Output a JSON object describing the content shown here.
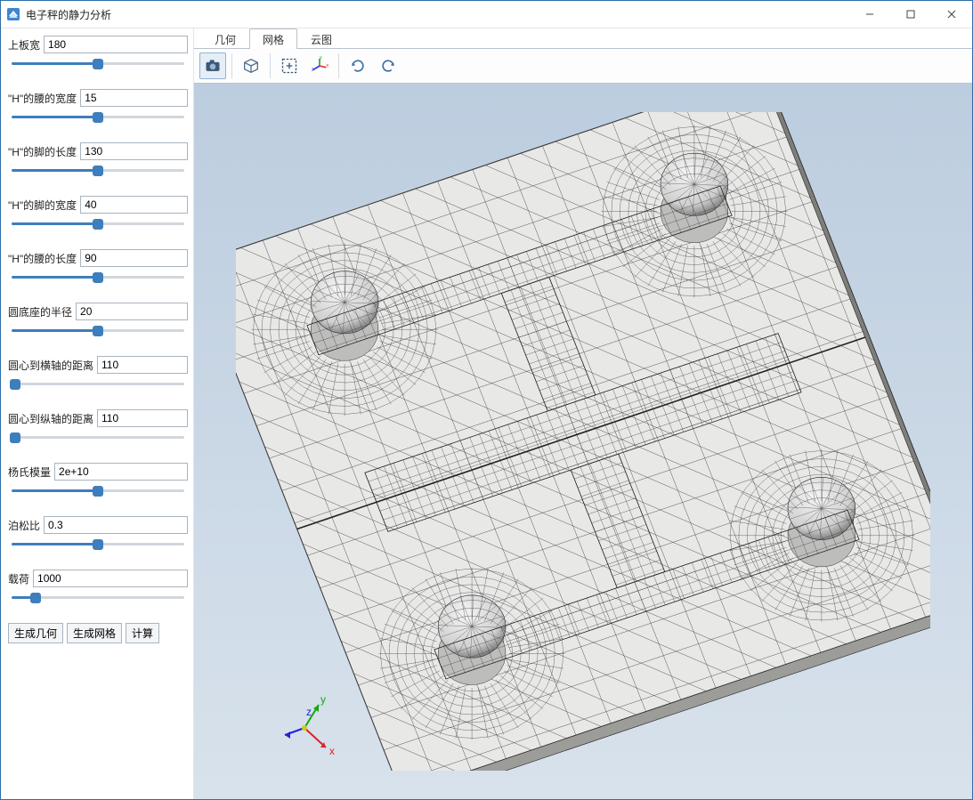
{
  "app": {
    "title": "电子秤的静力分析"
  },
  "window_controls": {
    "minimize_label": "Minimize",
    "maximize_label": "Maximize",
    "close_label": "Close"
  },
  "sidebar": {
    "params": [
      {
        "label": "上板宽",
        "value": "180",
        "pct": 50
      },
      {
        "label": "\"H\"的腰的宽度",
        "value": "15",
        "pct": 50
      },
      {
        "label": "\"H\"的脚的长度",
        "value": "130",
        "pct": 50
      },
      {
        "label": "\"H\"的脚的宽度",
        "value": "40",
        "pct": 50
      },
      {
        "label": "\"H\"的腰的长度",
        "value": "90",
        "pct": 50
      },
      {
        "label": "圆底座的半径",
        "value": "20",
        "pct": 50
      },
      {
        "label": "圆心到横轴的距离",
        "value": "110",
        "pct": 2
      },
      {
        "label": "圆心到纵轴的距离",
        "value": "110",
        "pct": 2
      },
      {
        "label": "杨氏模量",
        "value": "2e+10",
        "pct": 50
      },
      {
        "label": "泊松比",
        "value": "0.3",
        "pct": 50
      },
      {
        "label": "载荷",
        "value": "1000",
        "pct": 14
      }
    ],
    "actions": {
      "gen_geometry": "生成几何",
      "gen_mesh": "生成网格",
      "compute": "计算"
    }
  },
  "main": {
    "tabs": {
      "geometry": "几何",
      "mesh": "网格",
      "contour": "云图",
      "active": "mesh"
    },
    "toolbar": {
      "camera": "camera",
      "box": "iso-box",
      "fit": "zoom-fit",
      "axes": "axes-toggle",
      "rotate_ccw": "rotate-ccw",
      "rotate_cw": "rotate-cw"
    },
    "triad": {
      "x": "x",
      "y": "y",
      "z": "z"
    }
  }
}
